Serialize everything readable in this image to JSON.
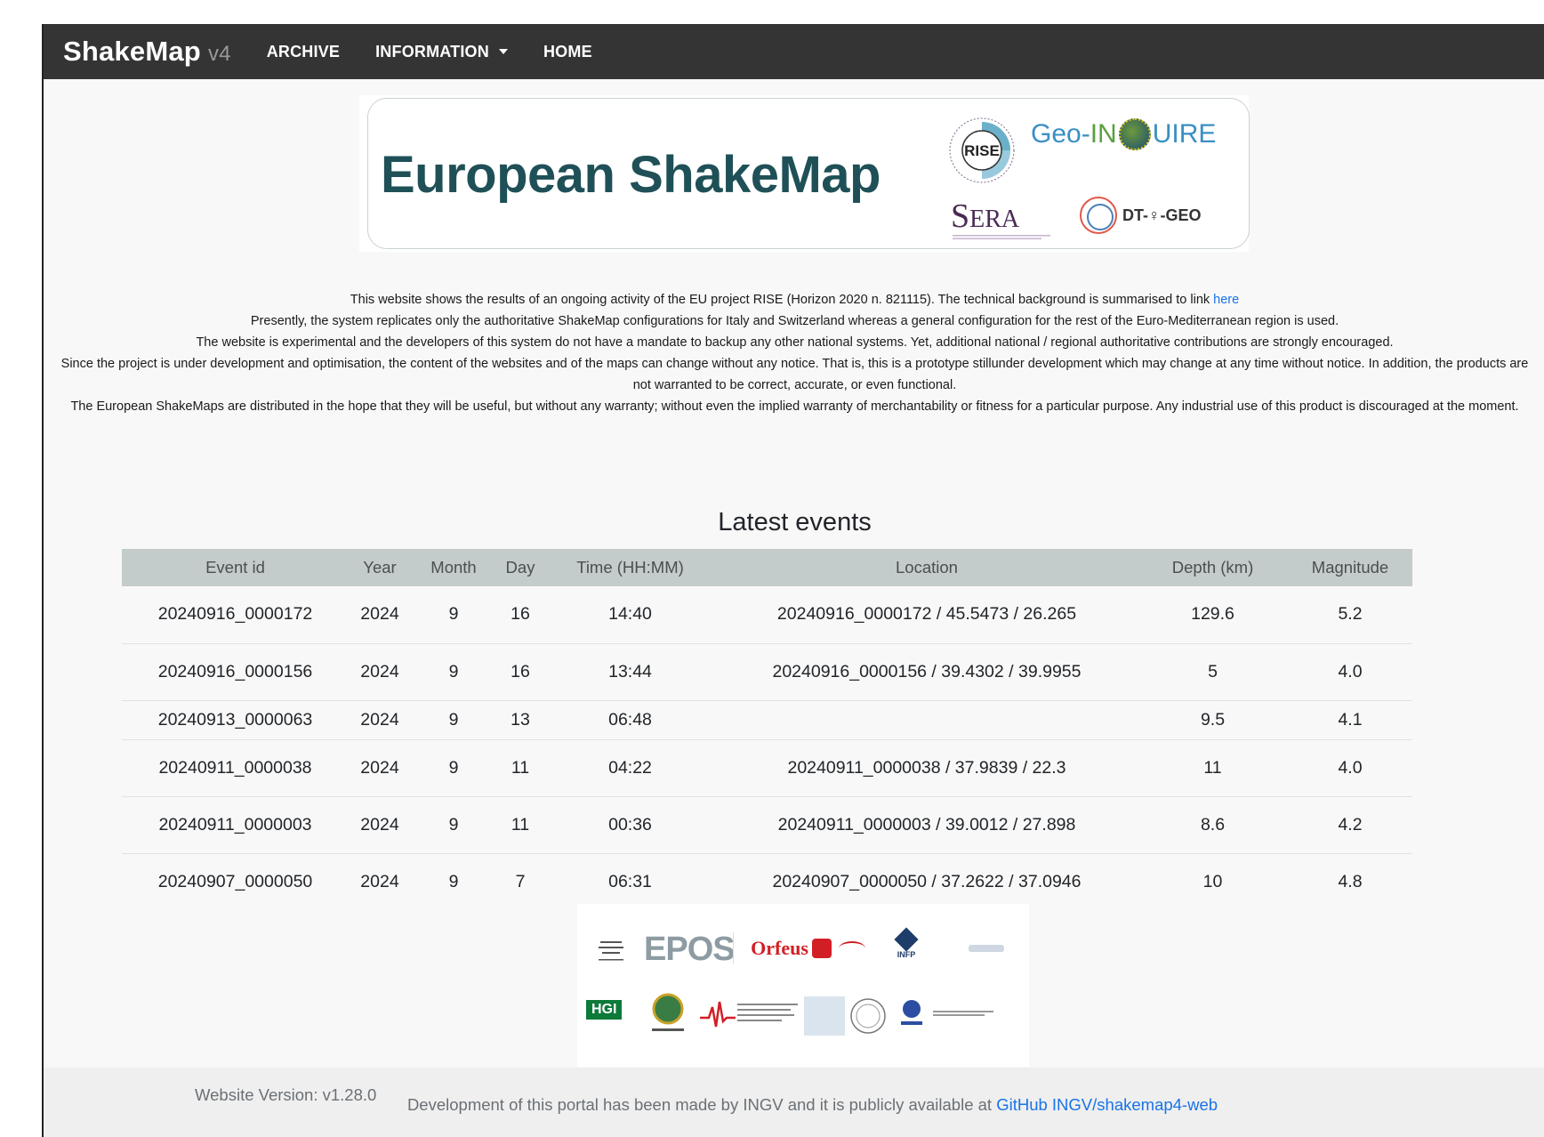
{
  "navbar": {
    "brand": "ShakeMap",
    "brand_version": "v4",
    "items": [
      {
        "label": "ARCHIVE"
      },
      {
        "label": "INFORMATION"
      },
      {
        "label": "HOME"
      }
    ]
  },
  "banner": {
    "title": "European ShakeMap",
    "logos": {
      "rise": "RISE",
      "geo_prefix": "Geo-",
      "geo_in": "IN",
      "geo_suffix": "UIRE",
      "sera_big": "S",
      "sera_rest": "ERA",
      "dtgeo": "DT-♀-GEO"
    }
  },
  "disclaimer": {
    "line1_text": "This website shows the results of an ongoing activity of the EU project RISE (Horizon 2020 n. 821115). The technical background is summarised to link ",
    "line1_link": "here",
    "line2": "Presently, the system replicates only the authoritative ShakeMap configurations for Italy and Switzerland whereas a general configuration for the rest of the Euro-Mediterranean region is used.",
    "line3": "The website is experimental and the developers of this system do not have a mandate to backup any other national systems. Yet, additional national / regional authoritative contributions are strongly encouraged.",
    "line4": "Since the project is under development and optimisation, the content of the websites and of the maps can change without any notice. That is, this is a prototype stillunder development which may change at any time without notice. In addition, the products are not warranted to be correct, accurate, or even functional.",
    "line5": "The European ShakeMaps are distributed in the hope that they will be useful, but without any warranty; without even the implied warranty of merchantability or fitness for a particular purpose. Any industrial use of this product is discouraged at the moment."
  },
  "events": {
    "title": "Latest events",
    "columns": [
      "Event id",
      "Year",
      "Month",
      "Day",
      "Time (HH:MM)",
      "Location",
      "Depth (km)",
      "Magnitude"
    ],
    "rows": [
      [
        "20240916_0000172",
        "2024",
        "9",
        "16",
        "14:40",
        "20240916_0000172 / 45.5473 / 26.265",
        "129.6",
        "5.2"
      ],
      [
        "20240916_0000156",
        "2024",
        "9",
        "16",
        "13:44",
        "20240916_0000156 / 39.4302 / 39.9955",
        "5",
        "4.0"
      ],
      [
        "20240913_0000063",
        "2024",
        "9",
        "13",
        "06:48",
        "",
        "9.5",
        "4.1"
      ],
      [
        "20240911_0000038",
        "2024",
        "9",
        "11",
        "04:22",
        "20240911_0000038 / 37.9839 / 22.3",
        "11",
        "4.0"
      ],
      [
        "20240911_0000003",
        "2024",
        "9",
        "11",
        "00:36",
        "20240911_0000003 / 39.0012 / 27.898",
        "8.6",
        "4.2"
      ],
      [
        "20240907_0000050",
        "2024",
        "9",
        "7",
        "06:31",
        "20240907_0000050 / 37.2622 / 37.0946",
        "10",
        "4.8"
      ]
    ]
  },
  "partners": {
    "epos": "EPOS",
    "orfeus": "Orfeus",
    "infp": "INFP",
    "hgi": "HGI"
  },
  "footer": {
    "version": "Website Version: v1.28.0",
    "dev_text": "Development of this portal has been made by INGV and it is publicly available at ",
    "dev_link": "GitHub INGV/shakemap4-web"
  }
}
